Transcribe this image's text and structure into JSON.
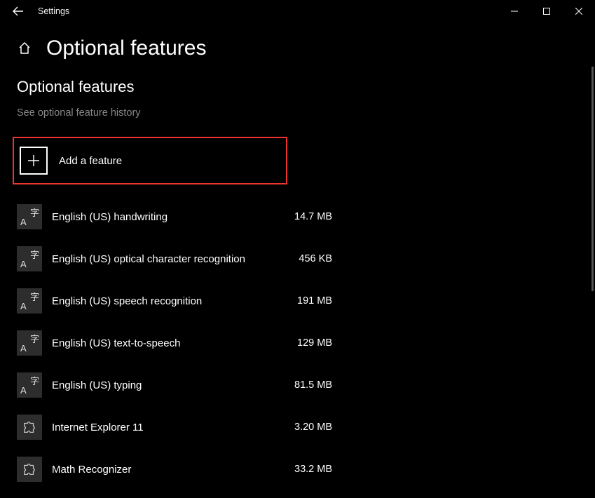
{
  "window": {
    "title": "Settings"
  },
  "header": {
    "page_title": "Optional features"
  },
  "subheader": "Optional features",
  "history_link": "See optional feature history",
  "add_feature_label": "Add a feature",
  "features": [
    {
      "name": "English (US) handwriting",
      "size": "14.7 MB",
      "icon": "lang"
    },
    {
      "name": "English (US) optical character recognition",
      "size": "456 KB",
      "icon": "lang"
    },
    {
      "name": "English (US) speech recognition",
      "size": "191 MB",
      "icon": "lang"
    },
    {
      "name": "English (US) text-to-speech",
      "size": "129 MB",
      "icon": "lang"
    },
    {
      "name": "English (US) typing",
      "size": "81.5 MB",
      "icon": "lang"
    },
    {
      "name": "Internet Explorer 11",
      "size": "3.20 MB",
      "icon": "puzzle"
    },
    {
      "name": "Math Recognizer",
      "size": "33.2 MB",
      "icon": "puzzle"
    }
  ]
}
